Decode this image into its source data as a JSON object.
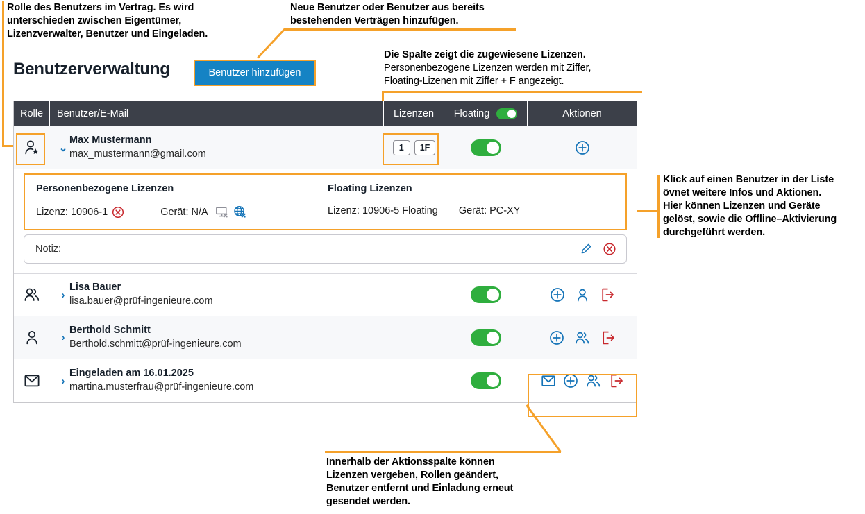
{
  "page": {
    "title": "Benutzerverwaltung",
    "add_button": "Benutzer hinzufügen"
  },
  "annotations": {
    "role": "Rolle des Benutzers im Vertrag. Es wird\nunterschieden zwischen Eigentümer,\nLizenzverwalter, Benutzer und Eingeladen.",
    "add_user": "Neue Benutzer oder Benutzer aus bereits\nbestehenden Verträgen hinzufügen.",
    "licenses_bold": "Die Spalte zeigt die zugewiesene Lizenzen.",
    "licenses_rest": "Personenbezogene Lizenzen werden mit Ziffer,\nFloating-Lizenen mit Ziffer + F angezeigt.",
    "expand": "Klick auf einen Benutzer in der Liste\növnet weitere Infos und Aktionen.\nHier können Lizenzen und Geräte\ngelöst, sowie die Offline–Aktivierung\ndurchgeführt werden.",
    "expand_fixed": "Klick auf einen Benutzer in der Liste\növnet weitere Infos und Aktionen.",
    "actions": "Innerhalb der Aktionsspalte können\nLizenzen vergeben, Rollen geändert,\nBenutzer entfernt und Einladung erneut\ngesendet werden."
  },
  "table": {
    "headers": {
      "role": "Rolle",
      "user": "Benutzer/E-Mail",
      "licenses": "Lizenzen",
      "floating": "Floating",
      "actions": "Aktionen"
    },
    "rows": [
      {
        "role_icon": "user-star-icon",
        "chevron": "⌄",
        "name": "Max Mustermann",
        "email": "max_mustermann@gmail.com",
        "licenses": [
          "1",
          "1F"
        ],
        "floating": "on",
        "actions": [
          "plus-circle-icon"
        ]
      },
      {
        "role_icon": "users-icon",
        "chevron": "›",
        "name": "Lisa Bauer",
        "email": "lisa.bauer@prüf-ingenieure.com",
        "licenses": [],
        "floating": "on",
        "actions": [
          "plus-circle-icon",
          "user-icon",
          "logout-icon"
        ]
      },
      {
        "role_icon": "user-icon",
        "chevron": "›",
        "name": "Berthold Schmitt",
        "email": "Berthold.schmitt@prüf-ingenieure.com",
        "licenses": [],
        "floating": "on",
        "actions": [
          "plus-circle-icon",
          "users-icon",
          "logout-icon"
        ]
      },
      {
        "role_icon": "envelope-icon",
        "chevron": "›",
        "name": "Eingeladen am 16.01.2025",
        "email": "martina.musterfrau@prüf-ingenieure.com",
        "licenses": [],
        "floating": "on",
        "actions": [
          "envelope-icon",
          "plus-circle-icon",
          "users-icon",
          "logout-icon"
        ]
      }
    ]
  },
  "detail": {
    "personal_title": "Personenbezogene Lizenzen",
    "personal_license": "Lizenz: 10906-1",
    "personal_device": "Gerät: N/A",
    "floating_title": "Floating Lizenzen",
    "floating_license": "Lizenz: 10906-5 Floating",
    "floating_device": "Gerät: PC-XY"
  },
  "notiz": {
    "label": "Notiz:"
  },
  "colors": {
    "accent_orange": "#F5A12A",
    "header_bg": "#3c4049",
    "toggle_green": "#2FAE3E",
    "button_blue": "#1583C4",
    "icon_blue": "#1574B8",
    "icon_red": "#C8282D"
  }
}
